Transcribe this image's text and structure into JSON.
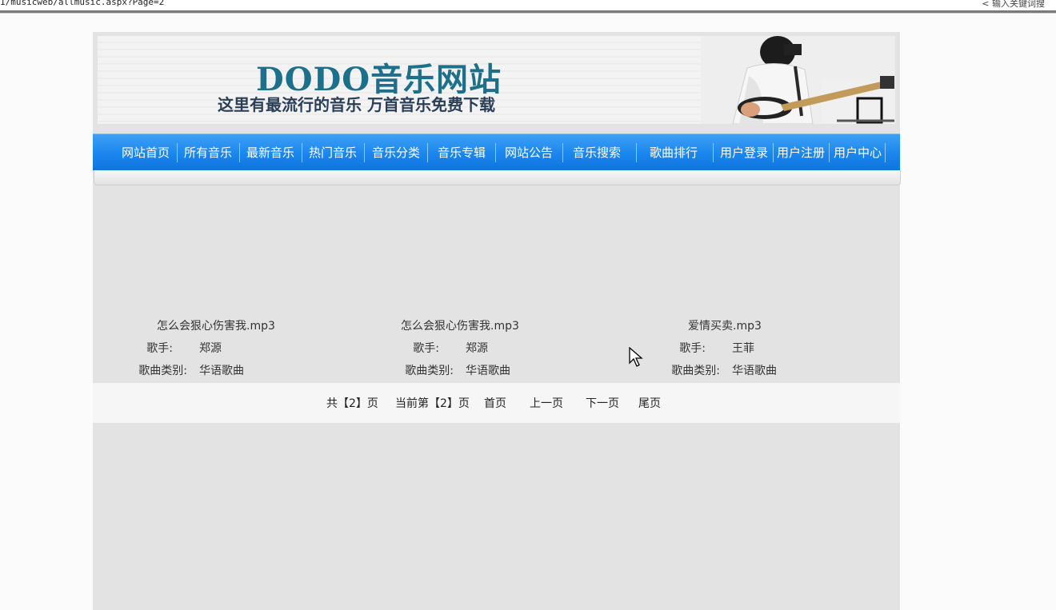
{
  "browser": {
    "url_fragment": "1/musicweb/allmusic.aspx?Page=2",
    "search_hint": "< 输入关键词搜"
  },
  "banner": {
    "title": "DODO音乐网站",
    "subtitle": "这里有最流行的音乐 万首音乐免费下载"
  },
  "nav": {
    "items": [
      "网站首页",
      "所有音乐",
      "最新音乐",
      "热门音乐",
      "音乐分类",
      "音乐专辑",
      "网站公告",
      "音乐搜索",
      "歌曲排行",
      "用户登录",
      "用户注册",
      "用户中心"
    ]
  },
  "songs": [
    {
      "title": "怎么会狠心伤害我.mp3",
      "singer_label": "歌手:",
      "singer": "郑源",
      "category_label": "歌曲类别:",
      "category": "华语歌曲"
    },
    {
      "title": "怎么会狠心伤害我.mp3",
      "singer_label": "歌手:",
      "singer": "郑源",
      "category_label": "歌曲类别:",
      "category": "华语歌曲"
    },
    {
      "title": "爱情买卖.mp3",
      "singer_label": "歌手:",
      "singer": "王菲",
      "category_label": "歌曲类别:",
      "category": "华语歌曲"
    }
  ],
  "pager": {
    "total": "共【2】页",
    "current": "当前第【2】页",
    "first": "首页",
    "prev": "上一页",
    "next": "下一页",
    "last": "尾页"
  },
  "colors": {
    "nav_blue": "#1a86ee",
    "title_teal": "#1e6f8a",
    "page_gray": "#e3e3e3"
  }
}
